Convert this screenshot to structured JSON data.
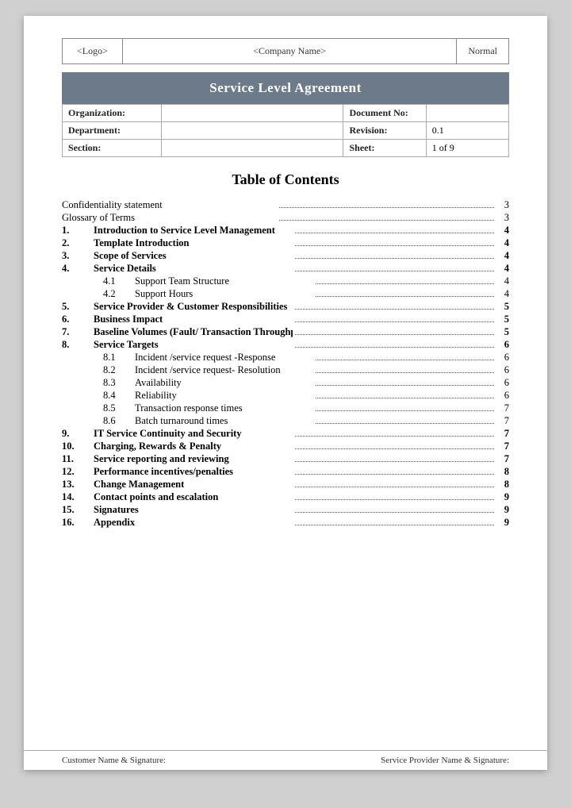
{
  "header": {
    "logo": "<Logo>",
    "company": "<Company Name>",
    "status": "Normal"
  },
  "title_banner": "Service Level Agreement",
  "info_table": {
    "rows": [
      {
        "label1": "Organization:",
        "value1": "",
        "label2": "Document No:",
        "value2": ""
      },
      {
        "label1": "Department:",
        "value1": "",
        "label2": "Revision:",
        "value2": "0.1"
      },
      {
        "label1": "Section:",
        "value1": "",
        "label2": "Sheet:",
        "value2": "1 of 9"
      }
    ]
  },
  "toc": {
    "title": "Table of Contents",
    "entries": [
      {
        "num": "",
        "label": "Confidentiality statement",
        "page": "3",
        "bold": false,
        "indent": false
      },
      {
        "num": "",
        "label": "Glossary of Terms",
        "page": "3",
        "bold": false,
        "indent": false
      },
      {
        "num": "1.",
        "label": "Introduction to Service Level Management",
        "page": "4",
        "bold": true,
        "indent": false
      },
      {
        "num": "2.",
        "label": "Template Introduction",
        "page": "4",
        "bold": true,
        "indent": false
      },
      {
        "num": "3.",
        "label": "Scope of Services",
        "page": "4",
        "bold": true,
        "indent": false
      },
      {
        "num": "4.",
        "label": "Service Details",
        "page": "4",
        "bold": true,
        "indent": false
      },
      {
        "num": "4.1",
        "label": "Support Team Structure",
        "page": "4",
        "bold": false,
        "indent": true
      },
      {
        "num": "4.2",
        "label": "Support Hours",
        "page": "4",
        "bold": false,
        "indent": true
      },
      {
        "num": "5.",
        "label": "Service Provider & Customer Responsibilities",
        "page": "5",
        "bold": true,
        "indent": false
      },
      {
        "num": "6.",
        "label": "Business Impact",
        "page": "5",
        "bold": true,
        "indent": false
      },
      {
        "num": "7.",
        "label": "Baseline Volumes (Fault/ Transaction Throughput)",
        "page": "5",
        "bold": true,
        "indent": false
      },
      {
        "num": "8.",
        "label": "Service Targets",
        "page": "6",
        "bold": true,
        "indent": false
      },
      {
        "num": "8.1",
        "label": "Incident /service request -Response",
        "page": "6",
        "bold": false,
        "indent": true
      },
      {
        "num": "8.2",
        "label": "Incident /service request- Resolution",
        "page": "6",
        "bold": false,
        "indent": true
      },
      {
        "num": "8.3",
        "label": "Availability",
        "page": "6",
        "bold": false,
        "indent": true
      },
      {
        "num": "8.4",
        "label": "Reliability",
        "page": "6",
        "bold": false,
        "indent": true
      },
      {
        "num": "8.5",
        "label": "Transaction response times",
        "page": "7",
        "bold": false,
        "indent": true
      },
      {
        "num": "8.6",
        "label": "Batch turnaround times",
        "page": "7",
        "bold": false,
        "indent": true
      },
      {
        "num": "9.",
        "label": "IT Service Continuity and Security",
        "page": "7",
        "bold": true,
        "indent": false
      },
      {
        "num": "10.",
        "label": "Charging, Rewards & Penalty",
        "page": "7",
        "bold": true,
        "indent": false
      },
      {
        "num": "11.",
        "label": "Service reporting and reviewing",
        "page": "7",
        "bold": true,
        "indent": false
      },
      {
        "num": "12.",
        "label": "Performance incentives/penalties",
        "page": "8",
        "bold": true,
        "indent": false
      },
      {
        "num": "13.",
        "label": "Change Management",
        "page": "8",
        "bold": true,
        "indent": false
      },
      {
        "num": "14.",
        "label": "Contact points and escalation",
        "page": "9",
        "bold": true,
        "indent": false
      },
      {
        "num": "15.",
        "label": "Signatures",
        "page": "9",
        "bold": true,
        "indent": false
      },
      {
        "num": "16.",
        "label": "Appendix",
        "page": "9",
        "bold": true,
        "indent": false
      }
    ]
  },
  "footer": {
    "left": "Customer Name & Signature:",
    "right": "Service Provider Name & Signature:"
  }
}
